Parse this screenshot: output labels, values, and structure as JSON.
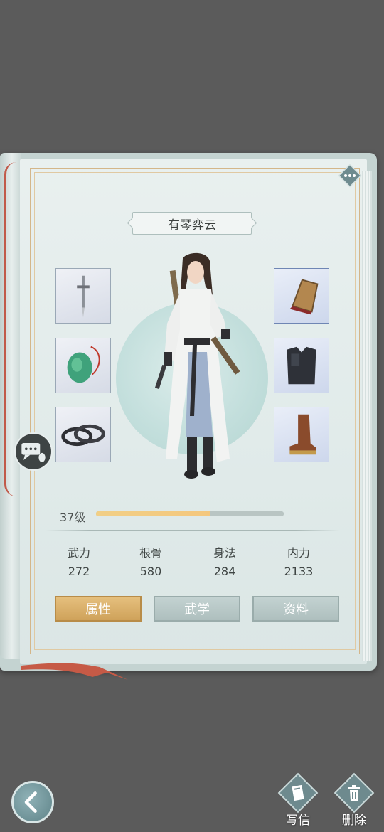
{
  "character": {
    "name": "有琴弈云"
  },
  "equipment": {
    "left": [
      {
        "slot": "weapon",
        "icon": "dagger-icon"
      },
      {
        "slot": "accessory",
        "icon": "jade-pendant-icon"
      },
      {
        "slot": "ring",
        "icon": "bracelet-icon"
      }
    ],
    "right": [
      {
        "slot": "bracer",
        "icon": "bracer-icon"
      },
      {
        "slot": "armor",
        "icon": "armor-vest-icon"
      },
      {
        "slot": "boots",
        "icon": "boot-icon"
      }
    ]
  },
  "level": {
    "label": "37级",
    "progress": 0.61
  },
  "stats": [
    {
      "label": "武力",
      "value": "272"
    },
    {
      "label": "根骨",
      "value": "580"
    },
    {
      "label": "身法",
      "value": "284"
    },
    {
      "label": "内力",
      "value": "2133"
    }
  ],
  "tabs": [
    {
      "label": "属性",
      "active": true
    },
    {
      "label": "武学",
      "active": false
    },
    {
      "label": "资料",
      "active": false
    }
  ],
  "actions": {
    "write_letter": "写信",
    "delete": "删除"
  },
  "colors": {
    "accent_gold": "#d8b272",
    "page_bg": "#e4eceb",
    "background": "#5b5b5b"
  }
}
